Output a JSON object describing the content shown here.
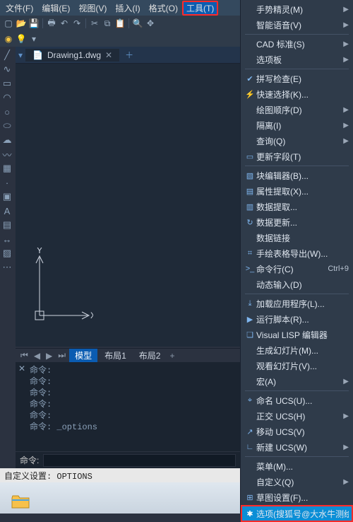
{
  "menubar": {
    "items": [
      {
        "label": "文件(F)"
      },
      {
        "label": "编辑(E)"
      },
      {
        "label": "视图(V)"
      },
      {
        "label": "插入(I)"
      },
      {
        "label": "格式(O)"
      },
      {
        "label": "工具(T)",
        "active": true
      }
    ]
  },
  "doc_tab": {
    "icon": "📄",
    "title": "Drawing1.dwg",
    "close": "✕",
    "plus": "＋"
  },
  "layout_tabs": {
    "nav": [
      "⏮",
      "◀",
      "▶",
      "⏭"
    ],
    "tabs": [
      {
        "label": "模型",
        "active": true
      },
      {
        "label": "布局1"
      },
      {
        "label": "布局2"
      }
    ],
    "plus": "+"
  },
  "axes": {
    "y": "Y",
    "x": "X"
  },
  "cmd": {
    "lines": [
      "命令:",
      "命令:",
      "命令:",
      "命令:",
      "命令:",
      "命令: _options"
    ],
    "prompt_label": "命令:",
    "input_value": ""
  },
  "status": "自定义设置: OPTIONS",
  "dropdown": {
    "items": [
      {
        "label": "手势精灵(M)",
        "arrow": true
      },
      {
        "label": "智能语音(V)",
        "arrow": true
      },
      {
        "sep": true
      },
      {
        "label": "CAD 标准(S)",
        "arrow": true
      },
      {
        "label": "选项板",
        "arrow": true
      },
      {
        "sep": true
      },
      {
        "icon": "✔",
        "label": "拼写检查(E)"
      },
      {
        "icon": "⚡",
        "label": "快速选择(K)..."
      },
      {
        "label": "绘图顺序(D)",
        "arrow": true
      },
      {
        "label": "隔离(I)",
        "arrow": true
      },
      {
        "label": "查询(Q)",
        "arrow": true
      },
      {
        "icon": "▭",
        "label": "更新字段(T)"
      },
      {
        "sep": true
      },
      {
        "icon": "▧",
        "label": "块编辑器(B)..."
      },
      {
        "icon": "▤",
        "label": "属性提取(X)..."
      },
      {
        "icon": "▥",
        "label": "数据提取..."
      },
      {
        "icon": "↻",
        "label": "数据更新..."
      },
      {
        "label": "数据链接"
      },
      {
        "icon": "⌗",
        "label": "手绘表格导出(W)..."
      },
      {
        "icon": ">_",
        "label": "命令行(C)",
        "shortcut": "Ctrl+9"
      },
      {
        "label": "动态输入(D)"
      },
      {
        "sep": true
      },
      {
        "icon": "⤓",
        "label": "加载应用程序(L)..."
      },
      {
        "icon": "▶",
        "label": "运行脚本(R)..."
      },
      {
        "icon": "❏",
        "label": "Visual LISP 编辑器"
      },
      {
        "label": "生成幻灯片(M)..."
      },
      {
        "label": "观看幻灯片(V)..."
      },
      {
        "label": "宏(A)",
        "arrow": true
      },
      {
        "sep": true
      },
      {
        "icon": "⌖",
        "label": "命名 UCS(U)..."
      },
      {
        "label": "正交 UCS(H)",
        "arrow": true
      },
      {
        "icon": "↗",
        "label": "移动 UCS(V)"
      },
      {
        "icon": "∟",
        "label": "新建 UCS(W)",
        "arrow": true
      },
      {
        "sep": true
      },
      {
        "label": "菜单(M)..."
      },
      {
        "label": "自定义(Q)",
        "arrow": true
      },
      {
        "icon": "⊞",
        "label": "草图设置(F)..."
      },
      {
        "icon": "✱",
        "label": "选项(搜狐号@大水牛测绘",
        "highlight": true
      }
    ]
  }
}
